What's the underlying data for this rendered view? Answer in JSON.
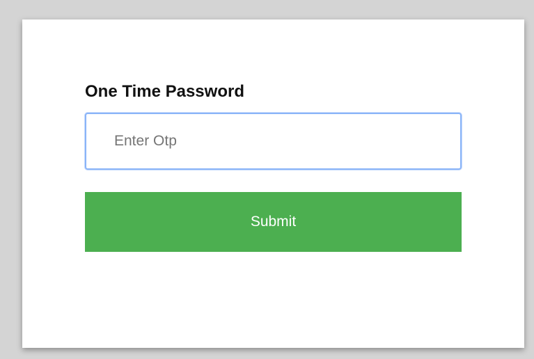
{
  "otp_form": {
    "title": "One Time Password",
    "input": {
      "value": "",
      "placeholder": "Enter Otp",
      "focus_color": "#8ab4f8"
    },
    "submit_label": "Submit",
    "submit_color": "#4caf50"
  }
}
